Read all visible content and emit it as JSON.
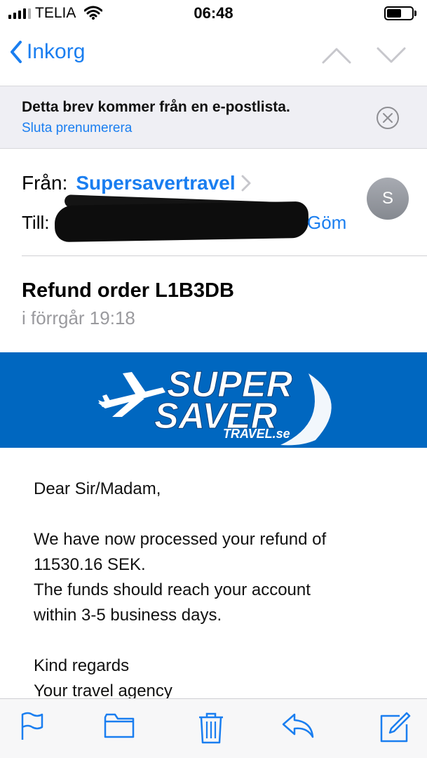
{
  "status_bar": {
    "carrier": "TELIA",
    "time": "06:48",
    "battery_level_percent": 60
  },
  "nav": {
    "back_label": "Inkorg",
    "accent_color": "#1a7ef0"
  },
  "list_banner": {
    "title": "Detta brev kommer från en e-postlista.",
    "unsubscribe_label": "Sluta prenumerera"
  },
  "header": {
    "from_label": "Från:",
    "from_name": "Supersavertravel",
    "to_label": "Till:",
    "hide_label": "Göm",
    "avatar_initial": "S"
  },
  "message": {
    "subject": "Refund order L1B3DB",
    "date": "i förrgår 19:18"
  },
  "logo": {
    "line1": "SUPER",
    "line2": "SAVER",
    "tag": "TRAVEL.se",
    "band_color": "#0067c0"
  },
  "body": {
    "greeting": "Dear Sir/Madam,",
    "line1": "We have now processed your refund of",
    "line2": "11530.16 SEK.",
    "line3": "The funds should reach your account",
    "line4": "within 3-5 business days.",
    "closing1": "Kind regards",
    "closing2": "Your travel agency"
  },
  "toolbar": {
    "icons": [
      "flag-icon",
      "folder-icon",
      "trash-icon",
      "reply-icon",
      "compose-icon"
    ]
  }
}
